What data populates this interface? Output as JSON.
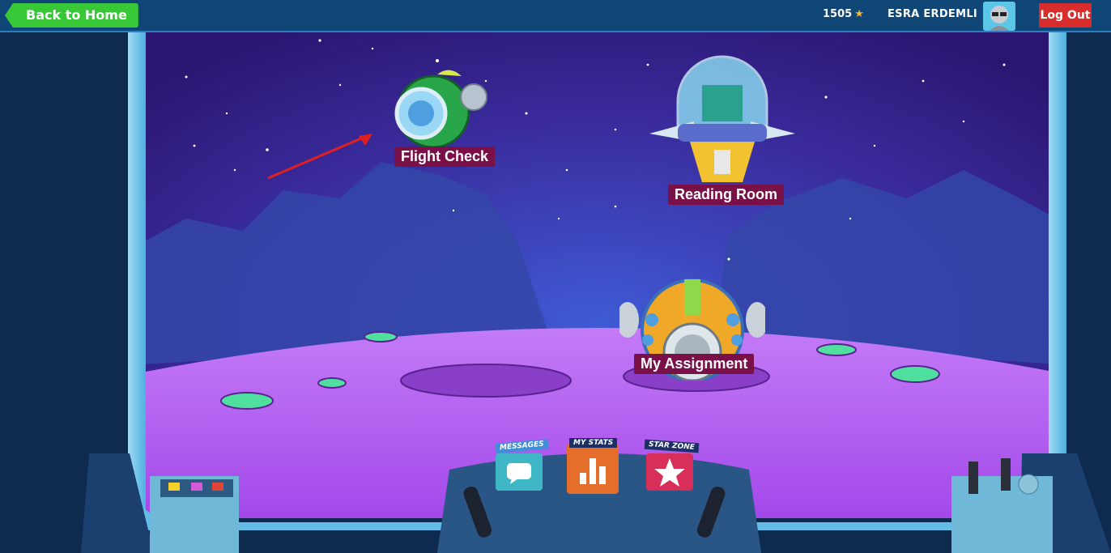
{
  "topbar": {
    "back_label": "Back to Home",
    "stars": "1505",
    "user_name": "ESRA ERDEMLI",
    "logout_label": "Log Out"
  },
  "destinations": {
    "flight_check": "Flight Check",
    "reading_room": "Reading Room",
    "my_assignment": "My Assignment"
  },
  "dock": {
    "messages": "MESSAGES",
    "my_stats": "MY STATS",
    "star_zone": "STAR ZONE"
  },
  "colors": {
    "accent_green": "#38c837",
    "logout_red": "#d72d2d",
    "label_maroon": "#7a1048",
    "topbar": "#0f4676",
    "planet": "#b05ff0"
  }
}
